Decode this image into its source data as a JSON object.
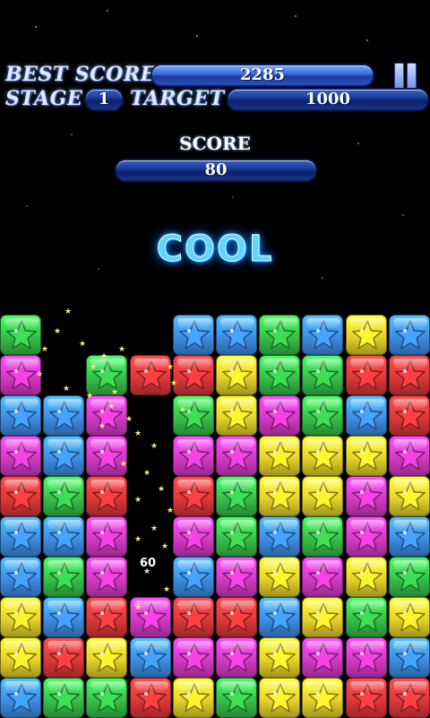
{
  "hud": {
    "best_score_label": "BEST SCORE",
    "best_score_value": "2285",
    "stage_label": "STAGE",
    "stage_value": "1",
    "target_label": "TARGET",
    "target_value": "1000",
    "score_label": "SCORE",
    "score_value": "80"
  },
  "message": "COOL",
  "combo_text": "60",
  "colors": {
    "green": "#36c24a",
    "pink": "#d63ac8",
    "blue": "#3d8fe6",
    "red": "#e0383a",
    "yellow": "#e8d42a",
    "accent_bar": "#2a4fc0"
  },
  "board": {
    "columns": 10,
    "rows": 10,
    "cells": [
      [
        "green",
        null,
        null,
        null,
        "blue",
        "blue",
        "green",
        "blue",
        "yellow",
        "blue"
      ],
      [
        "pink",
        null,
        "green",
        "red",
        "red",
        "yellow",
        "green",
        "green",
        "red",
        "red"
      ],
      [
        "blue",
        "blue",
        "pink",
        null,
        "green",
        "yellow",
        "pink",
        "green",
        "blue",
        "red"
      ],
      [
        "pink",
        "blue",
        "pink",
        null,
        "pink",
        "pink",
        "yellow",
        "yellow",
        "yellow",
        "pink"
      ],
      [
        "red",
        "green",
        "red",
        null,
        "red",
        "green",
        "yellow",
        "yellow",
        "pink",
        "yellow"
      ],
      [
        "blue",
        "blue",
        "pink",
        null,
        "pink",
        "green",
        "blue",
        "green",
        "pink",
        "blue"
      ],
      [
        "blue",
        "green",
        "pink",
        null,
        "blue",
        "pink",
        "yellow",
        "pink",
        "yellow",
        "green"
      ],
      [
        "yellow",
        "blue",
        "red",
        "pink",
        "red",
        "red",
        "blue",
        "yellow",
        "green",
        "yellow"
      ],
      [
        "yellow",
        "red",
        "yellow",
        "blue",
        "pink",
        "pink",
        "yellow",
        "pink",
        "pink",
        "blue"
      ],
      [
        "blue",
        "green",
        "green",
        "red",
        "yellow",
        "green",
        "yellow",
        "yellow",
        "red",
        "red"
      ]
    ]
  }
}
